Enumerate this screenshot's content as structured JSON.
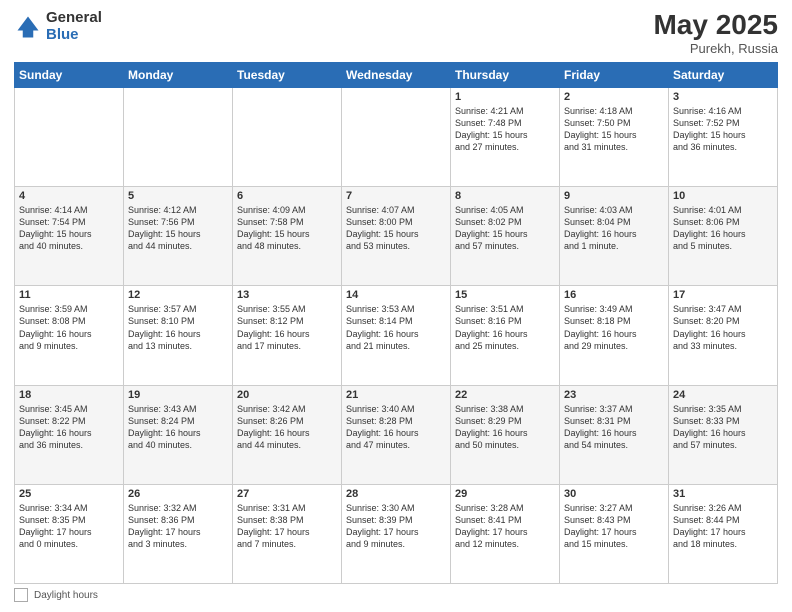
{
  "header": {
    "logo": {
      "general": "General",
      "blue": "Blue"
    },
    "month": "May 2025",
    "location": "Purekh, Russia"
  },
  "weekdays": [
    "Sunday",
    "Monday",
    "Tuesday",
    "Wednesday",
    "Thursday",
    "Friday",
    "Saturday"
  ],
  "weeks": [
    [
      {
        "day": "",
        "info": ""
      },
      {
        "day": "",
        "info": ""
      },
      {
        "day": "",
        "info": ""
      },
      {
        "day": "",
        "info": ""
      },
      {
        "day": "1",
        "info": "Sunrise: 4:21 AM\nSunset: 7:48 PM\nDaylight: 15 hours\nand 27 minutes."
      },
      {
        "day": "2",
        "info": "Sunrise: 4:18 AM\nSunset: 7:50 PM\nDaylight: 15 hours\nand 31 minutes."
      },
      {
        "day": "3",
        "info": "Sunrise: 4:16 AM\nSunset: 7:52 PM\nDaylight: 15 hours\nand 36 minutes."
      }
    ],
    [
      {
        "day": "4",
        "info": "Sunrise: 4:14 AM\nSunset: 7:54 PM\nDaylight: 15 hours\nand 40 minutes."
      },
      {
        "day": "5",
        "info": "Sunrise: 4:12 AM\nSunset: 7:56 PM\nDaylight: 15 hours\nand 44 minutes."
      },
      {
        "day": "6",
        "info": "Sunrise: 4:09 AM\nSunset: 7:58 PM\nDaylight: 15 hours\nand 48 minutes."
      },
      {
        "day": "7",
        "info": "Sunrise: 4:07 AM\nSunset: 8:00 PM\nDaylight: 15 hours\nand 53 minutes."
      },
      {
        "day": "8",
        "info": "Sunrise: 4:05 AM\nSunset: 8:02 PM\nDaylight: 15 hours\nand 57 minutes."
      },
      {
        "day": "9",
        "info": "Sunrise: 4:03 AM\nSunset: 8:04 PM\nDaylight: 16 hours\nand 1 minute."
      },
      {
        "day": "10",
        "info": "Sunrise: 4:01 AM\nSunset: 8:06 PM\nDaylight: 16 hours\nand 5 minutes."
      }
    ],
    [
      {
        "day": "11",
        "info": "Sunrise: 3:59 AM\nSunset: 8:08 PM\nDaylight: 16 hours\nand 9 minutes."
      },
      {
        "day": "12",
        "info": "Sunrise: 3:57 AM\nSunset: 8:10 PM\nDaylight: 16 hours\nand 13 minutes."
      },
      {
        "day": "13",
        "info": "Sunrise: 3:55 AM\nSunset: 8:12 PM\nDaylight: 16 hours\nand 17 minutes."
      },
      {
        "day": "14",
        "info": "Sunrise: 3:53 AM\nSunset: 8:14 PM\nDaylight: 16 hours\nand 21 minutes."
      },
      {
        "day": "15",
        "info": "Sunrise: 3:51 AM\nSunset: 8:16 PM\nDaylight: 16 hours\nand 25 minutes."
      },
      {
        "day": "16",
        "info": "Sunrise: 3:49 AM\nSunset: 8:18 PM\nDaylight: 16 hours\nand 29 minutes."
      },
      {
        "day": "17",
        "info": "Sunrise: 3:47 AM\nSunset: 8:20 PM\nDaylight: 16 hours\nand 33 minutes."
      }
    ],
    [
      {
        "day": "18",
        "info": "Sunrise: 3:45 AM\nSunset: 8:22 PM\nDaylight: 16 hours\nand 36 minutes."
      },
      {
        "day": "19",
        "info": "Sunrise: 3:43 AM\nSunset: 8:24 PM\nDaylight: 16 hours\nand 40 minutes."
      },
      {
        "day": "20",
        "info": "Sunrise: 3:42 AM\nSunset: 8:26 PM\nDaylight: 16 hours\nand 44 minutes."
      },
      {
        "day": "21",
        "info": "Sunrise: 3:40 AM\nSunset: 8:28 PM\nDaylight: 16 hours\nand 47 minutes."
      },
      {
        "day": "22",
        "info": "Sunrise: 3:38 AM\nSunset: 8:29 PM\nDaylight: 16 hours\nand 50 minutes."
      },
      {
        "day": "23",
        "info": "Sunrise: 3:37 AM\nSunset: 8:31 PM\nDaylight: 16 hours\nand 54 minutes."
      },
      {
        "day": "24",
        "info": "Sunrise: 3:35 AM\nSunset: 8:33 PM\nDaylight: 16 hours\nand 57 minutes."
      }
    ],
    [
      {
        "day": "25",
        "info": "Sunrise: 3:34 AM\nSunset: 8:35 PM\nDaylight: 17 hours\nand 0 minutes."
      },
      {
        "day": "26",
        "info": "Sunrise: 3:32 AM\nSunset: 8:36 PM\nDaylight: 17 hours\nand 3 minutes."
      },
      {
        "day": "27",
        "info": "Sunrise: 3:31 AM\nSunset: 8:38 PM\nDaylight: 17 hours\nand 7 minutes."
      },
      {
        "day": "28",
        "info": "Sunrise: 3:30 AM\nSunset: 8:39 PM\nDaylight: 17 hours\nand 9 minutes."
      },
      {
        "day": "29",
        "info": "Sunrise: 3:28 AM\nSunset: 8:41 PM\nDaylight: 17 hours\nand 12 minutes."
      },
      {
        "day": "30",
        "info": "Sunrise: 3:27 AM\nSunset: 8:43 PM\nDaylight: 17 hours\nand 15 minutes."
      },
      {
        "day": "31",
        "info": "Sunrise: 3:26 AM\nSunset: 8:44 PM\nDaylight: 17 hours\nand 18 minutes."
      }
    ]
  ],
  "footer": {
    "daylight_label": "Daylight hours"
  }
}
